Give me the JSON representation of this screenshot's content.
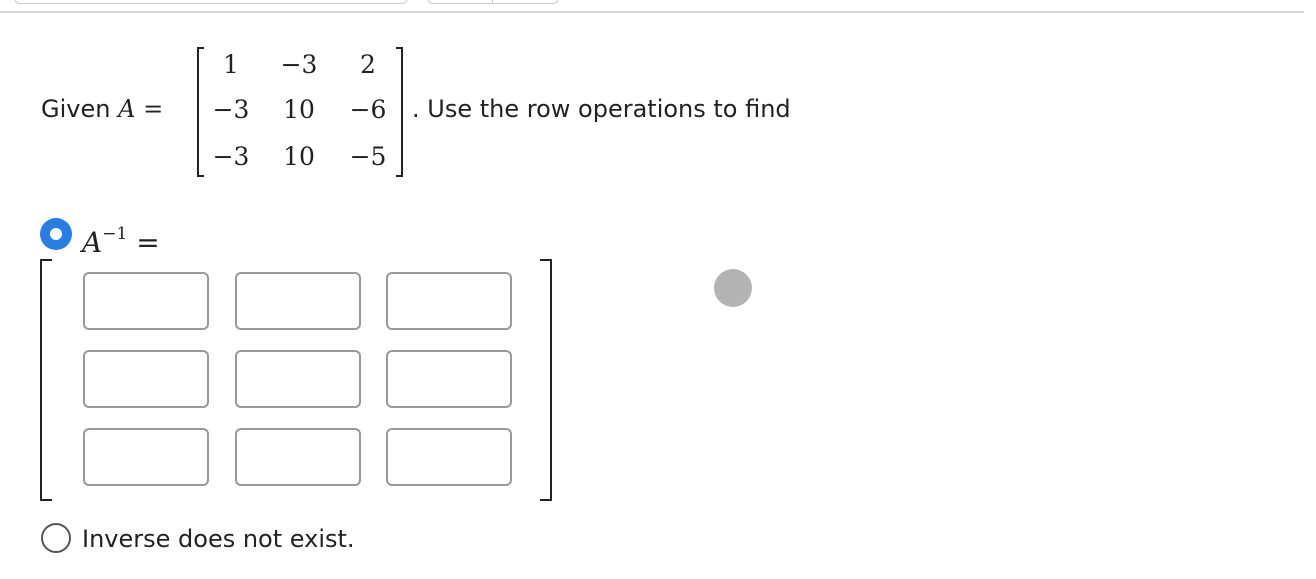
{
  "prompt": {
    "given_text": "Given",
    "matrix_symbol": "A",
    "equals": "=",
    "tail_text": ". Use the row operations to find"
  },
  "matrix_A": [
    [
      "1",
      "−3",
      "2"
    ],
    [
      "−3",
      "10",
      "−6"
    ],
    [
      "−3",
      "10",
      "−5"
    ]
  ],
  "options": {
    "inverse": {
      "symbol": "A",
      "exponent": "−1",
      "equals": "=",
      "selected": true,
      "entries": [
        [
          "",
          "",
          ""
        ],
        [
          "",
          "",
          ""
        ],
        [
          "",
          "",
          ""
        ]
      ]
    },
    "no_inverse": {
      "label": "Inverse does not exist.",
      "selected": false
    }
  },
  "colors": {
    "accent": "#2a7de1",
    "input_border": "#999999",
    "indicator": "#b3b3b3"
  }
}
